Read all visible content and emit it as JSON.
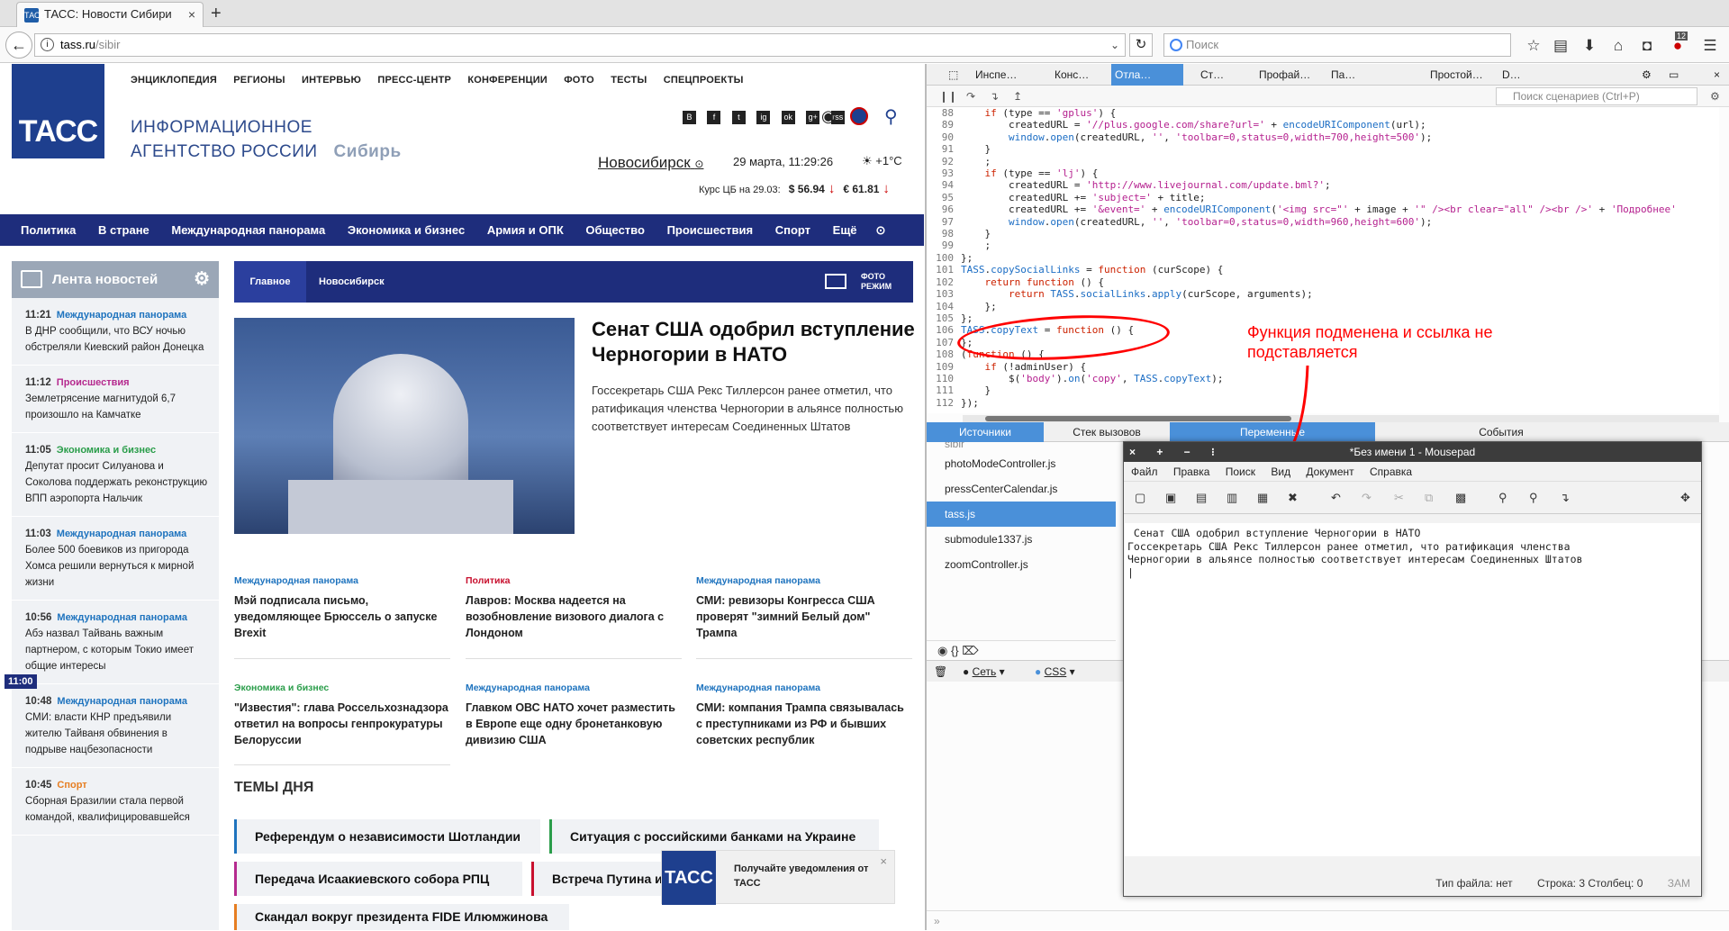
{
  "browser": {
    "tab_title": "ТАСС: Новости Сибири",
    "tab_favicon": "ТАСС",
    "new_tab": "+",
    "url_host": "tass.ru",
    "url_path": "/sibir",
    "search_placeholder": "Поиск",
    "badge": "12"
  },
  "site": {
    "logo": "ТАСС",
    "top_menu": [
      "ЭНЦИКЛОПЕДИЯ",
      "РЕГИОНЫ",
      "ИНТЕРВЬЮ",
      "ПРЕСС-ЦЕНТР",
      "КОНФЕРЕНЦИИ",
      "ФОТО",
      "ТЕСТЫ",
      "СПЕЦПРОЕКТЫ"
    ],
    "agency_line1": "ИНФОРМАЦИОННОЕ",
    "agency_line2": "АГЕНТСТВО РОССИИ",
    "region": "Сибирь",
    "social_icons": [
      "В",
      "f",
      "t",
      "ig",
      "ok",
      "g+",
      "rss"
    ],
    "city": "Новосибирск",
    "datetime": "29 марта, 11:29:26",
    "weather": "+1°C",
    "rates_label": "Курс ЦБ на 29.03:",
    "usd": "$ 56.94",
    "eur": "€ 61.81",
    "rate_arrow": "↓",
    "main_nav": [
      "Политика",
      "В стране",
      "Международная панорама",
      "Экономика и бизнес",
      "Армия и ОПК",
      "Общество",
      "Происшествия",
      "Спорт",
      "Ещё"
    ],
    "feed_title": "Лента новостей",
    "feed": [
      {
        "time": "11:21",
        "cat": "Международная панорама",
        "text": "В ДНР сообщили, что ВСУ ночью обстреляли Киевский район Донецка"
      },
      {
        "time": "11:12",
        "cat": "Происшествия",
        "text": "Землетрясение магнитудой 6,7 произошло на Камчатке"
      },
      {
        "time": "11:05",
        "cat": "Экономика и бизнес",
        "text": "Депутат просит Силуанова и Соколова поддержать реконструкцию ВПП аэропорта Нальчик"
      },
      {
        "time": "11:03",
        "cat": "Международная панорама",
        "text": "Более 500 боевиков из пригорода Хомса решили вернуться к мирной жизни"
      },
      {
        "time": "10:56",
        "cat": "Международная панорама",
        "text": "Абэ назвал Тайвань важным партнером, с которым Токио имеет общие интересы"
      },
      {
        "time": "10:48",
        "cat": "Международная панорама",
        "text": "СМИ: власти КНР предъявили жителю Тайваня обвинения в подрыве нацбезопасности"
      },
      {
        "time": "10:45",
        "cat": "Спорт",
        "text": "Сборная Бразилии стала первой командой, квалифицировавшейся"
      }
    ],
    "time_badge": "11:00",
    "tab_main": "Главное",
    "tab_city": "Новосибирск",
    "photo_mode": "ФОТО РЕЖИМ",
    "hero_title": "Сенат США одобрил вступление Черногории в НАТО",
    "hero_text": "Госсекретарь США Рекс Тиллерсон ранее отметил, что ратификация членства Черногории в альянсе полностью соответствует интересам Соединенных Штатов",
    "grid": [
      {
        "cat": "Международная панорама",
        "color": "#1e73be",
        "text": "Мэй подписала письмо, уведомляющее Брюссель о запуске Brexit"
      },
      {
        "cat": "Политика",
        "color": "#c8102e",
        "text": "Лавров: Москва надеется на возобновление визового диалога с Лондоном"
      },
      {
        "cat": "Международная панорама",
        "color": "#1e73be",
        "text": "СМИ: ревизоры Конгресса США проверят \"зимний Белый дом\" Трампа"
      },
      {
        "cat": "Экономика и бизнес",
        "color": "#2a9d4a",
        "text": "\"Известия\": глава Россельхознадзора ответил на вопросы генпрокуратуры Белоруссии"
      },
      {
        "cat": "Международная панорама",
        "color": "#1e73be",
        "text": "Главком ОВС НАТО хочет разместить в Европе еще одну бронетанковую дивизию США"
      },
      {
        "cat": "Международная панорама",
        "color": "#1e73be",
        "text": "СМИ: компания Трампа связывалась с преступниками из РФ и бывших советских республик"
      }
    ],
    "themes_title": "ТЕМЫ ДНЯ",
    "themes": [
      {
        "text": "Референдум о независимости Шотландии",
        "color": "#1e73be"
      },
      {
        "text": "Ситуация с российскими банками на Украине",
        "color": "#2a9d4a"
      },
      {
        "text": "Передача Исаакиевского собора РПЦ",
        "color": "#b52a8e"
      },
      {
        "text": "Встреча Путина и Е",
        "color": "#c8102e"
      },
      {
        "text": "Скандал вокруг президента FIDE Илюмжинова",
        "color": "#e67e22"
      }
    ],
    "notif_logo": "ТАСС",
    "notif_text": "Получайте уведомления от ТАСС",
    "notif_close": "×"
  },
  "devtools": {
    "tabs": [
      "Инспе…",
      "Конс…",
      "Отла…",
      "Ст…",
      "Профай…",
      "Па…",
      "Простой…",
      "D…"
    ],
    "script_search": "Поиск сценариев (Ctrl+P)",
    "code": [
      {
        "n": "88",
        "html": "    <span class=\"kw\">if</span> (type == <span class=\"st\">'gplus'</span>) {"
      },
      {
        "n": "89",
        "html": "        createdURL = <span class=\"st\">'//plus.google.com/share?url='</span> + <span class=\"fn\">encodeURIComponent</span>(url);"
      },
      {
        "n": "90",
        "html": "        <span class=\"fn\">window</span>.<span class=\"fn\">open</span>(createdURL, <span class=\"st\">''</span>, <span class=\"st\">'toolbar=0,status=0,width=700,height=500'</span>);"
      },
      {
        "n": "91",
        "html": "    }"
      },
      {
        "n": "92",
        "html": "    ;"
      },
      {
        "n": "93",
        "html": "    <span class=\"kw\">if</span> (type == <span class=\"st\">'lj'</span>) {"
      },
      {
        "n": "94",
        "html": "        createdURL = <span class=\"st\">'http://www.livejournal.com/update.bml?'</span>;"
      },
      {
        "n": "95",
        "html": "        createdURL += <span class=\"st\">'subject='</span> + title;"
      },
      {
        "n": "96",
        "html": "        createdURL += <span class=\"st\">'&amp;event='</span> + <span class=\"fn\">encodeURIComponent</span>(<span class=\"st\">'&lt;img src=\"'</span> + image + <span class=\"st\">'\" /&gt;&lt;br clear=\"all\" /&gt;&lt;br /&gt;'</span> + <span class=\"st\">'Подробнее'</span>"
      },
      {
        "n": "97",
        "html": "        <span class=\"fn\">window</span>.<span class=\"fn\">open</span>(createdURL, <span class=\"st\">''</span>, <span class=\"st\">'toolbar=0,status=0,width=960,height=600'</span>);"
      },
      {
        "n": "98",
        "html": "    }"
      },
      {
        "n": "99",
        "html": "    ;"
      },
      {
        "n": "100",
        "html": "};"
      },
      {
        "n": "101",
        "html": "<span class=\"fn\">TASS</span>.<span class=\"fn\">copySocialLinks</span> = <span class=\"kw\">function</span> (curScope) {"
      },
      {
        "n": "102",
        "html": "    <span class=\"kw\">return</span> <span class=\"kw\">function</span> () {"
      },
      {
        "n": "103",
        "html": "        <span class=\"kw\">return</span> <span class=\"fn\">TASS</span>.<span class=\"fn\">socialLinks</span>.<span class=\"fn\">apply</span>(curScope, arguments);"
      },
      {
        "n": "104",
        "html": "    };"
      },
      {
        "n": "105",
        "html": "};"
      },
      {
        "n": "106",
        "html": "<span class=\"fn\">TASS</span>.<span class=\"fn\">copyText</span> = <span class=\"kw\">function</span> () {"
      },
      {
        "n": "107",
        "html": "};"
      },
      {
        "n": "108",
        "html": "(<span class=\"kw\">function</span> () {"
      },
      {
        "n": "109",
        "html": "    <span class=\"kw\">if</span> (!adminUser) {"
      },
      {
        "n": "110",
        "html": "        $(<span class=\"st\">'body'</span>).<span class=\"fn\">on</span>(<span class=\"st\">'copy'</span>, <span class=\"fn\">TASS</span>.<span class=\"fn\">copyText</span>);"
      },
      {
        "n": "111",
        "html": "    }"
      },
      {
        "n": "112",
        "html": "});"
      }
    ],
    "annotation": "Функция подменена и ссылка не подставляется",
    "low_tabs": [
      "Источники",
      "Стек вызовов",
      "Переменные",
      "События"
    ],
    "sources": [
      "sibir",
      "photoModeController.js",
      "pressCenterCalendar.js",
      "tass.js",
      "submodule1337.js",
      "zoomController.js"
    ],
    "src_icons": "◉   {}   ⌦",
    "console_filters": [
      "Сеть",
      "CSS"
    ]
  },
  "mousepad": {
    "title": "*Без имени 1 - Mousepad",
    "menu": [
      "Файл",
      "Правка",
      "Поиск",
      "Вид",
      "Документ",
      "Справка"
    ],
    "text": " Сенат США одобрил вступление Черногории в НАТО\nГоссекретарь США Рекс Тиллерсон ранее отметил, что ратификация членства\nЧерногории в альянсе полностью соответствует интересам Соединенных Штатов\n|",
    "status_type": "Тип файла: нет",
    "status_pos": "Строка: 3 Столбец: 0",
    "status_mode": "ЗАМ"
  }
}
